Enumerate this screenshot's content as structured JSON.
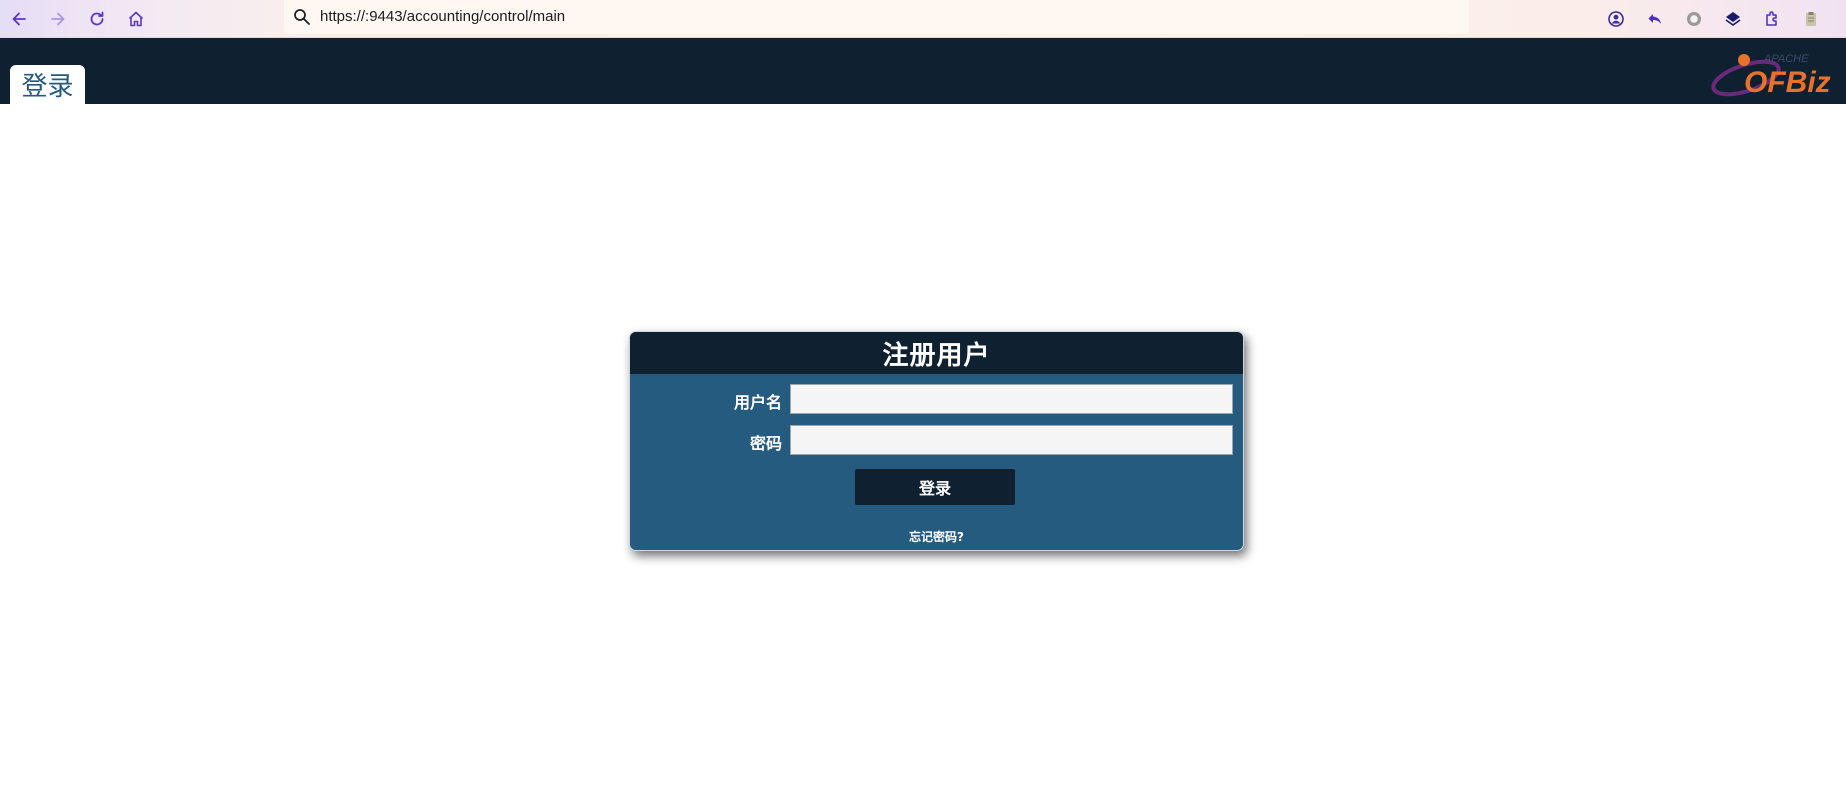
{
  "browser": {
    "url": "https://:9443/accounting/control/main"
  },
  "header": {
    "login_tab_label": "登录",
    "logo_text": "OFBiz",
    "logo_small_text": "APACHE"
  },
  "login_form": {
    "title": "注册用户",
    "username_label": "用户名",
    "username_value": "",
    "password_label": "密码",
    "password_value": "",
    "submit_label": "登录",
    "forgot_password_label": "忘记密码?"
  },
  "colors": {
    "header_bg": "#0f2131",
    "form_bg": "#265b80",
    "tab_text": "#245a80"
  }
}
